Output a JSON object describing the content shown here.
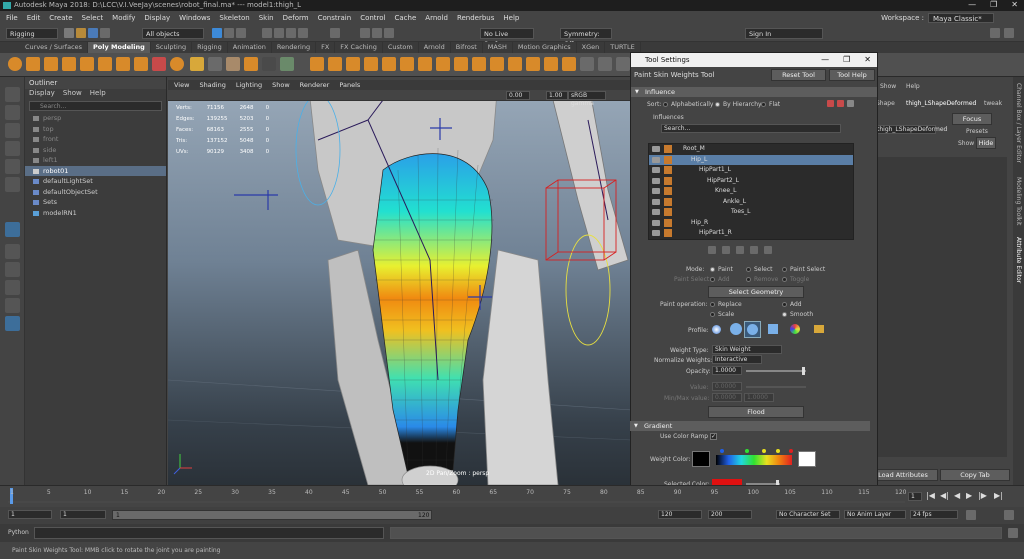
{
  "window": {
    "title": "Autodesk Maya 2018: D:\\LCC\\V.I.VeeJay\\scenes\\robot_final.ma* --- model1:thigh_L",
    "controls": [
      "—",
      "❐",
      "✕"
    ]
  },
  "menubar": {
    "items": [
      "File",
      "Edit",
      "Create",
      "Select",
      "Modify",
      "Display",
      "Windows",
      "Skeleton",
      "Skin",
      "Deform",
      "Constrain",
      "Control",
      "Cache",
      "Arnold",
      "Renderbus",
      "Help"
    ],
    "workspace_label": "Workspace :",
    "workspace_value": "Maya Classic*"
  },
  "statusline": {
    "mode": "Rigging",
    "objects": "All objects",
    "live_surface": "No Live Surface",
    "symmetry": "Symmetry: Off",
    "sign_in": "Sign In"
  },
  "shelf": {
    "tabs": [
      "Curves / Surfaces",
      "Poly Modeling",
      "Sculpting",
      "Rigging",
      "Animation",
      "Rendering",
      "FX",
      "FX Caching",
      "Custom",
      "Arnold",
      "Bifrost",
      "MASH",
      "Motion Graphics",
      "XGen",
      "TURTLE"
    ],
    "active_tab": "Poly Modeling"
  },
  "outliner": {
    "title": "Outliner",
    "menu": [
      "Display",
      "Show",
      "Help"
    ],
    "search_placeholder": "Search...",
    "items": [
      {
        "label": "persp",
        "dim": true
      },
      {
        "label": "top",
        "dim": true
      },
      {
        "label": "front",
        "dim": true
      },
      {
        "label": "side",
        "dim": true
      },
      {
        "label": "left1",
        "dim": true
      },
      {
        "label": "robot01",
        "dim": false,
        "selected": true
      },
      {
        "label": "defaultLightSet",
        "dim": false
      },
      {
        "label": "defaultObjectSet",
        "dim": false
      },
      {
        "label": "Sets",
        "dim": false
      },
      {
        "label": "modelRN1",
        "dim": false
      }
    ]
  },
  "viewport": {
    "menu": [
      "View",
      "Shading",
      "Lighting",
      "Show",
      "Renderer",
      "Panels"
    ],
    "gamma": "sRGB gamma",
    "values": [
      "0.00",
      "1.00"
    ],
    "hud": [
      {
        "name": "Verts:",
        "a": "71156",
        "b": "2648",
        "c": "0"
      },
      {
        "name": "Edges:",
        "a": "139255",
        "b": "5203",
        "c": "0"
      },
      {
        "name": "Faces:",
        "a": "68163",
        "b": "2555",
        "c": "0"
      },
      {
        "name": "Tris:",
        "a": "137152",
        "b": "5048",
        "c": "0"
      },
      {
        "name": "UVs:",
        "a": "90129",
        "b": "3408",
        "c": "0"
      }
    ],
    "camera_label": "2D Pan/Zoom : persp"
  },
  "tool_settings": {
    "title": "Tool Settings",
    "tool_name": "Paint Skin Weights Tool",
    "reset_label": "Reset Tool",
    "help_label": "Tool Help",
    "influence_section": "Influence",
    "sort_label": "Sort:",
    "sort_options": [
      "Alphabetically",
      "By Hierarchy",
      "Flat"
    ],
    "sort_selected": 1,
    "influences_label": "Influences",
    "search_placeholder": "Search...",
    "joints": [
      {
        "label": "Root_M",
        "indent": 0,
        "selected": false
      },
      {
        "label": "Hip_L",
        "indent": 1,
        "selected": true
      },
      {
        "label": "HipPart1_L",
        "indent": 2,
        "selected": false
      },
      {
        "label": "HipPart2_L",
        "indent": 3,
        "selected": false
      },
      {
        "label": "Knee_L",
        "indent": 4,
        "selected": false
      },
      {
        "label": "Ankle_L",
        "indent": 5,
        "selected": false
      },
      {
        "label": "Toes_L",
        "indent": 6,
        "selected": false
      },
      {
        "label": "Hip_R",
        "indent": 1,
        "selected": false
      },
      {
        "label": "HipPart1_R",
        "indent": 2,
        "selected": false
      }
    ],
    "mode_label": "Mode:",
    "mode_options": [
      "Paint",
      "Select",
      "Paint Select"
    ],
    "paint_select_label": "Paint Select:",
    "paint_select_options": [
      "Add",
      "Remove",
      "Toggle"
    ],
    "select_geometry": "Select Geometry",
    "paint_op_label": "Paint operation:",
    "paint_ops": [
      "Replace",
      "Add",
      "Scale",
      "Smooth"
    ],
    "paint_op_selected": "Smooth",
    "profile_label": "Profile:",
    "weight_type_label": "Weight Type:",
    "weight_type_value": "Skin Weight",
    "normalize_label": "Normalize Weights:",
    "normalize_value": "Interactive",
    "opacity_label": "Opacity:",
    "opacity_value": "1.0000",
    "value_label": "Value:",
    "value_value": "0.0000",
    "minmax_label": "Min/Max value:",
    "min_value": "0.0000",
    "max_value": "1.0000",
    "flood_label": "Flood",
    "gradient_section": "Gradient",
    "color_ramp_label": "Use Color Ramp",
    "weight_color_label": "Weight Color:",
    "selected_color_label": "Selected Color:",
    "selected_color": "#e01010"
  },
  "right_panel": {
    "tabs": [
      "Shape",
      "thigh_LShapeDeformed",
      "tweak"
    ],
    "shape_field": "thigh_LShapeDeformed",
    "focus": "Focus",
    "presets": "Presets",
    "show": "Show",
    "hide": "Hide",
    "show_menu": "Show",
    "help_menu": "Help",
    "add_attr": "Load Attributes",
    "copy_tab": "Copy Tab",
    "side_tabs": [
      "Channel Box / Layer Editor",
      "Modeling Toolkit",
      "Attribute Editor"
    ]
  },
  "timeline": {
    "ticks": [
      "1",
      "5",
      "10",
      "15",
      "20",
      "25",
      "30",
      "35",
      "40",
      "45",
      "50",
      "55",
      "60",
      "65",
      "70",
      "75",
      "80",
      "85",
      "90",
      "95",
      "100",
      "105",
      "110",
      "115",
      "120"
    ],
    "current_frame": "1"
  },
  "range": {
    "start": "1",
    "start2": "1",
    "slider_start": "1",
    "slider_end": "120",
    "end": "120",
    "end2": "200",
    "character_set": "No Character Set",
    "anim_layer": "No Anim Layer",
    "fps": "24 fps"
  },
  "cmdline": {
    "lang": "Python"
  },
  "helpline": {
    "text": "Paint Skin Weights Tool: MMB click to rotate the joint you are painting"
  }
}
